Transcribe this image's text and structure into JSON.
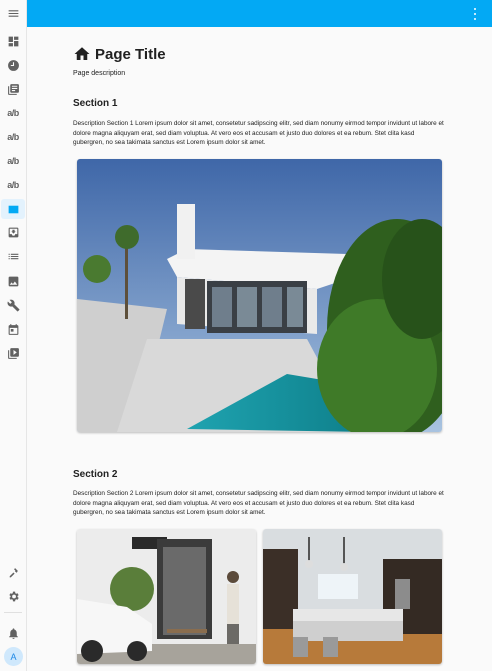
{
  "page": {
    "title": "Page Title",
    "description": "Page description"
  },
  "sections": [
    {
      "title": "Section 1",
      "description": "Description Section 1 Lorem ipsum dolor sit amet, consetetur sadipscing elitr, sed diam nonumy eirmod tempor invidunt ut labore et dolore magna aliquyam erat, sed diam voluptua. At vero eos et accusam et justo duo dolores et ea rebum. Stet clita kasd gubergren, no sea takimata sanctus est Lorem ipsum dolor sit amet."
    },
    {
      "title": "Section 2",
      "description": "Description Section 2 Lorem ipsum dolor sit amet, consetetur sadipscing elitr, sed diam nonumy eirmod tempor invidunt ut labore et dolore magna aliquyam erat, sed diam voluptua. At vero eos et accusam et justo duo dolores et ea rebum. Stet clita kasd gubergren, no sea takimata sanctus est Lorem ipsum dolor sit amet."
    }
  ],
  "sidebar": {
    "items": [
      {
        "icon": "dashboard-icon"
      },
      {
        "icon": "clock-icon"
      },
      {
        "icon": "library-icon"
      },
      {
        "icon": "fraction-icon",
        "label": "a/b"
      },
      {
        "icon": "fraction-icon",
        "label": "a/b"
      },
      {
        "icon": "fraction-icon",
        "label": "a/b"
      },
      {
        "icon": "fraction-icon",
        "label": "a/b"
      },
      {
        "icon": "rectangle-icon",
        "active": true
      },
      {
        "icon": "inbox-icon"
      },
      {
        "icon": "list-icon"
      },
      {
        "icon": "image-icon"
      },
      {
        "icon": "wrench-icon"
      },
      {
        "icon": "calendar-icon"
      },
      {
        "icon": "video-library-icon"
      }
    ],
    "avatar": "A"
  },
  "colors": {
    "topbar": "#03a9f4",
    "active": "#03a9f4",
    "active_bg": "#e3f2fd"
  }
}
